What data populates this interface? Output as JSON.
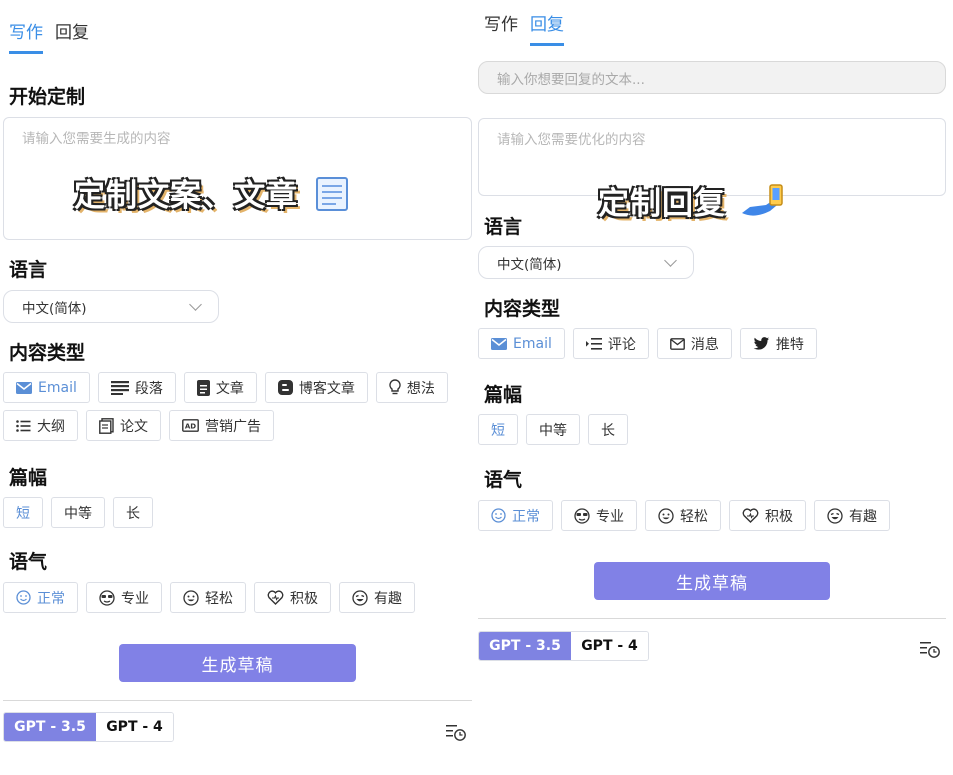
{
  "left": {
    "tabs": [
      "写作",
      "回复"
    ],
    "start_title": "开始定制",
    "content_placeholder": "请输入您需要生成的内容",
    "overlay": "定制文案、文章",
    "language_title": "语言",
    "language_value": "中文(简体)",
    "content_type_title": "内容类型",
    "content_types": [
      "Email",
      "段落",
      "文章",
      "博客文章",
      "想法",
      "大纲",
      "论文",
      "营销广告"
    ],
    "length_title": "篇幅",
    "lengths": [
      "短",
      "中等",
      "长"
    ],
    "tone_title": "语气",
    "tones": [
      "正常",
      "专业",
      "轻松",
      "积极",
      "有趣"
    ],
    "generate_label": "生成草稿",
    "models": [
      "GPT - 3.5",
      "GPT - 4"
    ]
  },
  "right": {
    "tabs": [
      "写作",
      "回复"
    ],
    "reply_placeholder": "输入你想要回复的文本...",
    "content_placeholder": "请输入您需要优化的内容",
    "overlay": "定制回复",
    "language_title": "语言",
    "language_value": "中文(简体)",
    "content_type_title": "内容类型",
    "content_types": [
      "Email",
      "评论",
      "消息",
      "推特"
    ],
    "length_title": "篇幅",
    "lengths": [
      "短",
      "中等",
      "长"
    ],
    "tone_title": "语气",
    "tones": [
      "正常",
      "专业",
      "轻松",
      "积极",
      "有趣"
    ],
    "generate_label": "生成草稿",
    "models": [
      "GPT - 3.5",
      "GPT - 4"
    ]
  },
  "colors": {
    "accent": "#3a8ee6",
    "button": "#8181e6",
    "model_active": "#7f83e2",
    "overlay_shadow": "#e3b36a"
  },
  "icons": {
    "content_types": [
      "mail-icon",
      "paragraph-icon",
      "document-icon",
      "blog-icon",
      "bulb-icon",
      "list-icon",
      "paper-icon",
      "ad-icon"
    ],
    "reply_types": [
      "mail-icon",
      "comment-icon",
      "message-icon",
      "twitter-icon"
    ],
    "tones": [
      "smile-icon",
      "sunglasses-icon",
      "relaxed-icon",
      "heart-icon",
      "fun-icon"
    ]
  }
}
